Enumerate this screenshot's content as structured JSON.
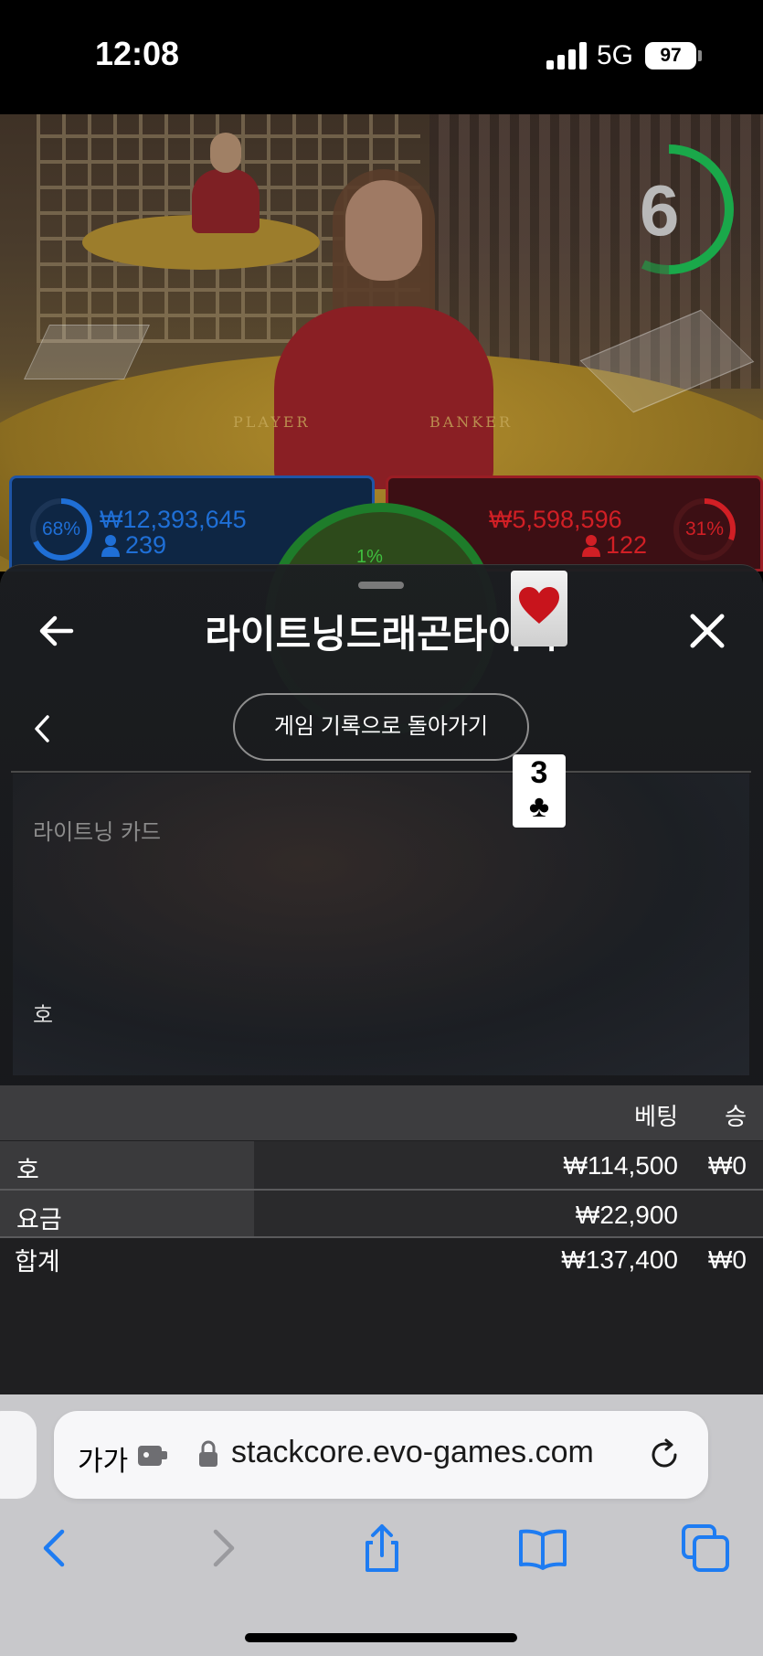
{
  "status_bar": {
    "time": "12:08",
    "network": "5G",
    "battery": "97"
  },
  "video": {
    "countdown": "6",
    "table_labels": {
      "player": "PLAYER",
      "banker": "BANKER"
    },
    "player_stats": {
      "percent": "68%",
      "amount": "₩12,393,645",
      "players": "239"
    },
    "banker_stats": {
      "percent": "31%",
      "amount": "₩5,598,596",
      "players": "122"
    },
    "tie_percent": "1%",
    "colors": {
      "player": "#1f6fd6",
      "banker": "#d11f25",
      "tie": "#22a33a"
    }
  },
  "panel": {
    "title": "라이트닝드래곤타이거",
    "back_icon": "arrow-left-icon",
    "close_icon": "close-icon",
    "history_button": "게임 기록으로 돌아가기",
    "lightning_card_label": "라이트닝 카드",
    "lightning_card": {
      "suit": "heart",
      "color": "#c8141c"
    },
    "tiger_label": "호",
    "tiger_card": {
      "rank": "3",
      "suit": "♣"
    }
  },
  "bets": {
    "headers": {
      "bet": "베팅",
      "win": "승"
    },
    "rows": [
      {
        "label": "호",
        "bet": "₩114,500",
        "win": "₩0"
      },
      {
        "label": "요금",
        "bet": "₩22,900",
        "win": ""
      }
    ],
    "total": {
      "label": "합계",
      "bet": "₩137,400",
      "win": "₩0"
    }
  },
  "browser": {
    "text_size": "가가",
    "url": "stackcore.evo-games.com",
    "accent": "#1e7cf2"
  }
}
